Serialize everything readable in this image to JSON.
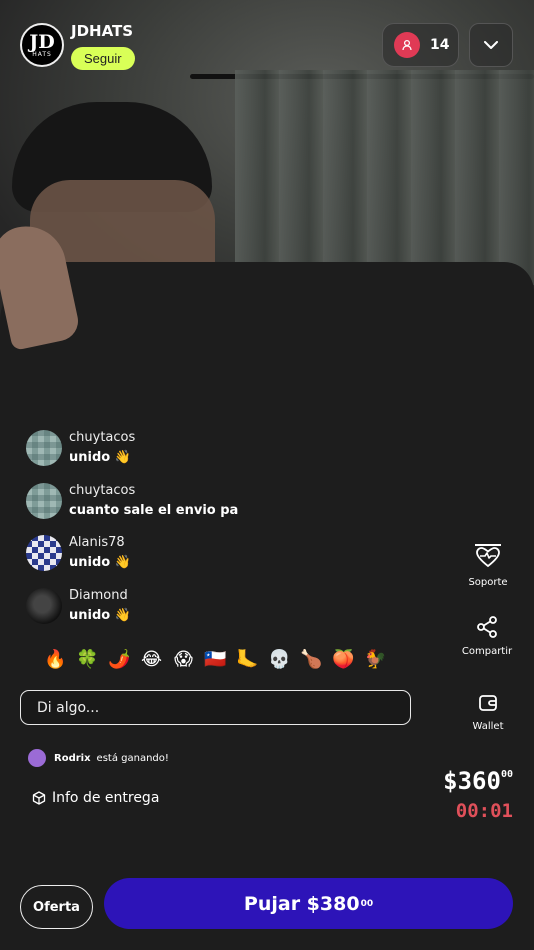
{
  "header": {
    "logo_text": "JD",
    "logo_subtext": "HATS",
    "streamer_name": "JDHATS",
    "follow_label": "Seguir",
    "viewer_count": "14"
  },
  "chat": [
    {
      "user": "chuytacos",
      "message": "unido 👋"
    },
    {
      "user": "chuytacos",
      "message": "cuanto sale el envio pa"
    },
    {
      "user": "Alanis78",
      "message": "unido 👋"
    },
    {
      "user": "Diamond",
      "message": "unido 👋"
    }
  ],
  "emojis": [
    "🔥",
    "🍀",
    "🌶️",
    "😂",
    "😱",
    "🇨🇱",
    "🦶",
    "💀",
    "🍗",
    "🍑",
    "🐓"
  ],
  "chat_input": {
    "placeholder": "Di algo..."
  },
  "winning": {
    "user": "Rodrix",
    "text": "está ganando!"
  },
  "delivery_info_label": "Info de entrega",
  "side_actions": {
    "support": "Soporte",
    "share": "Compartir",
    "wallet": "Wallet"
  },
  "auction": {
    "current_price": "$360",
    "current_price_cents": "00",
    "timer": "00:01",
    "bid_label": "Pujar $380",
    "bid_cents": "00"
  },
  "offer_label": "Oferta",
  "colors": {
    "follow_bg": "#d9ff57",
    "bid_button": "#2d14b8",
    "timer": "#e0505a",
    "viewer_badge": "#e03a55"
  }
}
